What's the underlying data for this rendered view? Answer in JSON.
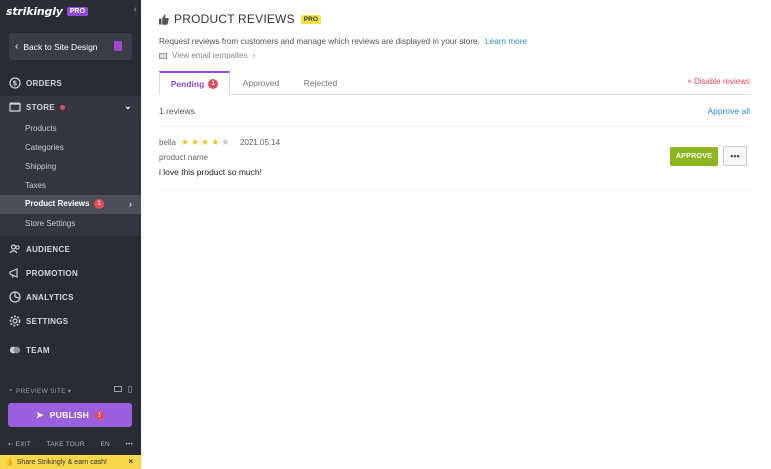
{
  "sidebar": {
    "brand": "strikingly",
    "brand_badge": "PRO",
    "back_label": "Back to Site Design",
    "nav": {
      "orders": "ORDERS",
      "store": "STORE",
      "audience": "AUDIENCE",
      "promotion": "PROMOTION",
      "analytics": "ANALYTICS",
      "settings": "SETTINGS",
      "team": "TEAM"
    },
    "store_sub": {
      "products": "Products",
      "categories": "Categories",
      "shipping": "Shipping",
      "taxes": "Taxes",
      "product_reviews": "Product Reviews",
      "product_reviews_badge": "1",
      "store_settings": "Store Settings"
    },
    "preview_label": "PREVIEW SITE",
    "publish_label": "PUBLISH",
    "footer": {
      "exit": "EXIT",
      "take_tour": "TAKE TOUR",
      "lang": "EN",
      "more": "•••"
    },
    "share_text": "Share Strikingly & earn cash!",
    "share_close": "×"
  },
  "page": {
    "title": "PRODUCT REVIEWS",
    "title_badge": "PRO",
    "description": "Request reviews from customers and manage which reviews are displayed in your store.",
    "learn_more": "Learn more",
    "email_templates": "View email tempaltes",
    "tabs": {
      "pending": "Pending",
      "pending_badge": "1",
      "approved": "Approved",
      "rejected": "Rejected"
    },
    "disable_reviews": "Disable reviews",
    "review_count": "1 reviews",
    "approve_all": "Approve all",
    "review": {
      "author": "bella",
      "rating": 4,
      "rating_max": 5,
      "date": "2021.05.14",
      "product": "product name",
      "body": "i love this product so much!",
      "approve_label": "APPROVE",
      "more_label": "•••"
    }
  },
  "colors": {
    "sidebar_bg": "#2a2c34",
    "accent_purple": "#8e4bd9",
    "approve_green": "#8cb51f",
    "badge_red": "#e54a5a",
    "link_blue": "#2a8bd4",
    "star_gold": "#f2c21a",
    "star_empty": "#c8c8c8"
  }
}
